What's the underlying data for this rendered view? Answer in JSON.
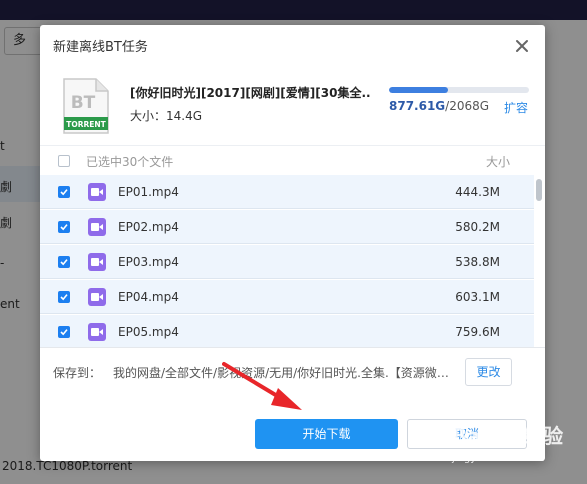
{
  "background": {
    "button_label": "多",
    "left_fragments": [
      "t",
      "劇",
      "劇",
      "-",
      "ent"
    ],
    "filename": "2018.TC1080P.torrent"
  },
  "dialog": {
    "title": "新建离线BT任务",
    "close_icon": "close-icon"
  },
  "task": {
    "icon_text_main": "BT",
    "icon_text_sub": "TORRENT",
    "name": "[你好旧时光][2017][网剧][爱情][30集全...",
    "size_label": "大小：",
    "size_value": "14.4G"
  },
  "quota": {
    "used": "877.61G",
    "separator": "/",
    "total": "2068G",
    "fill_fraction": 0.424,
    "expand_label": "扩容"
  },
  "list": {
    "header_label": "已选中30个文件",
    "size_header": "大小",
    "files": [
      {
        "name": "EP01.mp4",
        "size": "444.3M"
      },
      {
        "name": "EP02.mp4",
        "size": "580.2M"
      },
      {
        "name": "EP03.mp4",
        "size": "538.8M"
      },
      {
        "name": "EP04.mp4",
        "size": "603.1M"
      },
      {
        "name": "EP05.mp4",
        "size": "759.6M"
      }
    ]
  },
  "save": {
    "label": "保存到：",
    "path": "我的网盘/全部文件/影视资源/无用/你好旧时光.全集.【资源微博…",
    "change_label": "更改"
  },
  "actions": {
    "start_label": "开始下载",
    "cancel_label": "取消"
  },
  "watermark": {
    "main": "Baidu 经验",
    "sub": "jingyan.baidu.com"
  },
  "colors": {
    "accent": "#1f93f2",
    "quota_fill": "#3d7fe0",
    "video_icon": "#8f6bea",
    "arrow": "#e8262a"
  }
}
